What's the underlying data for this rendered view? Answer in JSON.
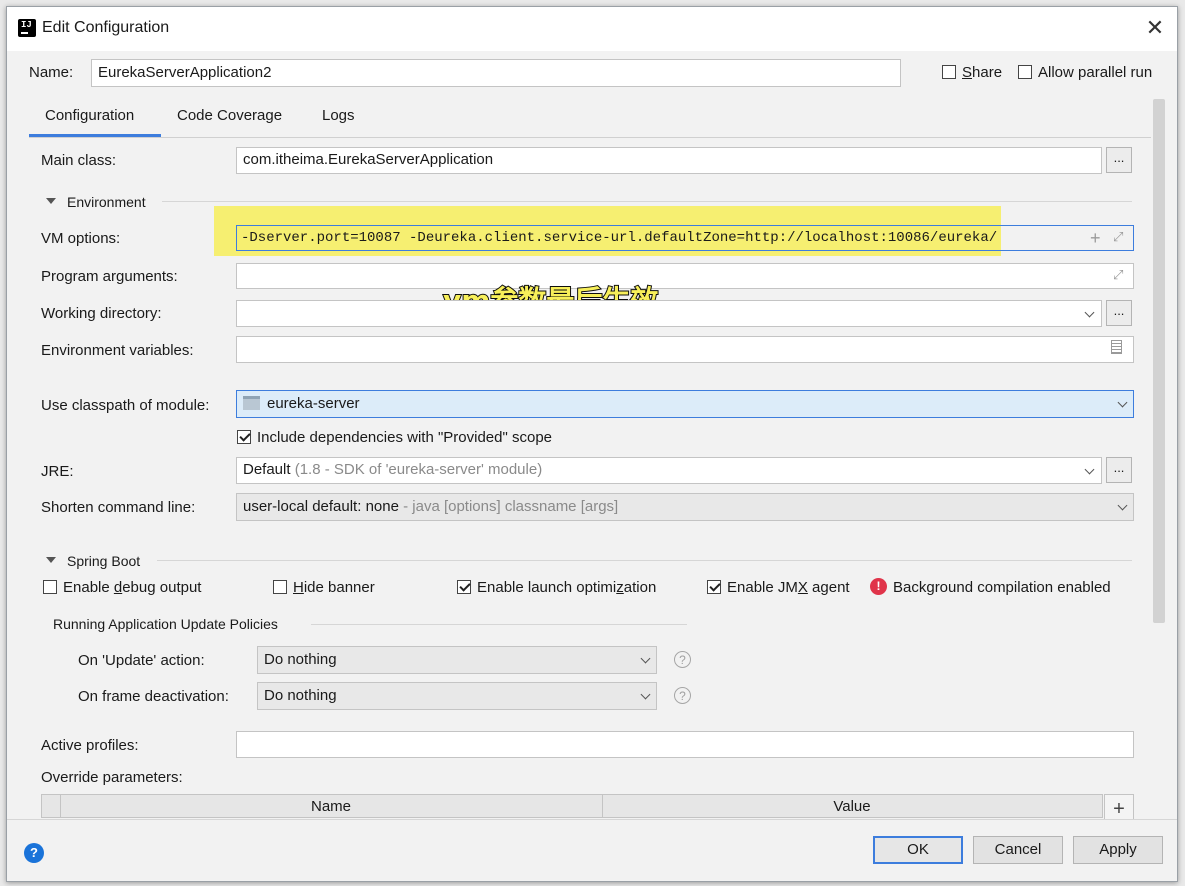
{
  "window": {
    "title": "Edit Configuration",
    "close_glyph": "✕"
  },
  "name_row": {
    "label": "Name:",
    "value": "EurekaServerApplication2",
    "share_label": "Share",
    "share_checked": false,
    "parallel_label": "Allow parallel run",
    "parallel_checked": false
  },
  "tabs": [
    {
      "label": "Configuration",
      "active": true
    },
    {
      "label": "Code Coverage",
      "active": false
    },
    {
      "label": "Logs",
      "active": false
    }
  ],
  "main_class": {
    "label": "Main class:",
    "value": "com.itheima.EurekaServerApplication",
    "browse_label": "..."
  },
  "environment": {
    "header": "Environment",
    "vm_options": {
      "label": "VM options:",
      "value": "-Dserver.port=10087 -Deureka.client.service-url.defaultZone=http://localhost:10086/eureka/"
    },
    "program_args": {
      "label": "Program arguments:",
      "value": ""
    },
    "working_dir": {
      "label": "Working directory:",
      "value": "",
      "browse_label": "..."
    },
    "env_vars": {
      "label": "Environment variables:",
      "value": ""
    }
  },
  "annotation": {
    "text": "vm参数最后生效",
    "highlight_color": "#f7ef5a"
  },
  "classpath": {
    "label": "Use classpath of module:",
    "value": "eureka-server"
  },
  "include_deps": {
    "label": "Include dependencies with \"Provided\" scope",
    "checked": true
  },
  "jre": {
    "label": "JRE:",
    "value": "Default",
    "detail": "(1.8 - SDK of 'eureka-server' module)",
    "browse_label": "..."
  },
  "shorten": {
    "label": "Shorten command line:",
    "value": "user-local default: none",
    "detail": "- java [options] classname [args]"
  },
  "spring_boot": {
    "header": "Spring Boot",
    "debug": {
      "label": "Enable debug output",
      "checked": false
    },
    "hide_banner": {
      "label": "Hide banner",
      "checked": false
    },
    "launch_opt": {
      "label": "Enable launch optimization",
      "checked": true
    },
    "jmx": {
      "label": "Enable JMX agent",
      "checked": true
    },
    "bg_compile": {
      "label": "Background compilation enabled"
    }
  },
  "update_policies": {
    "header": "Running Application Update Policies",
    "update_action": {
      "label": "On 'Update' action:",
      "value": "Do nothing"
    },
    "frame_deactivation": {
      "label": "On frame deactivation:",
      "value": "Do nothing"
    }
  },
  "active_profiles": {
    "label": "Active profiles:",
    "value": ""
  },
  "override": {
    "label": "Override parameters:",
    "columns": [
      "Name",
      "Value"
    ]
  },
  "buttons": {
    "ok": "OK",
    "cancel": "Cancel",
    "apply": "Apply"
  },
  "colors": {
    "accent": "#3d7ddd",
    "selected_bg": "#dcecf9",
    "error": "#e0344a",
    "help": "#1a73d9"
  }
}
